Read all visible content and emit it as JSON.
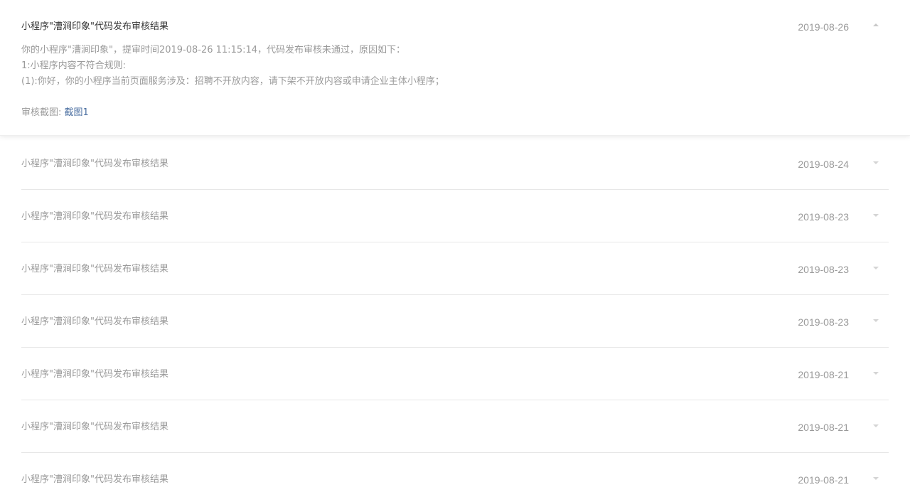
{
  "expanded": {
    "title": "小程序\"漕涧印象\"代码发布审核结果",
    "date": "2019-08-26",
    "lines": [
      "你的小程序\"漕涧印象\"，提审时间2019-08-26 11:15:14，代码发布审核未通过，原因如下：",
      "1:小程序内容不符合规则:",
      "(1):你好，你的小程序当前页面服务涉及：招聘不开放内容，请下架不开放内容或申请企业主体小程序；"
    ],
    "screenshot_label": "审核截图: ",
    "screenshot_link": "截图1"
  },
  "rows": [
    {
      "title": "小程序\"漕涧印象\"代码发布审核结果",
      "date": "2019-08-24"
    },
    {
      "title": "小程序\"漕涧印象\"代码发布审核结果",
      "date": "2019-08-23"
    },
    {
      "title": "小程序\"漕涧印象\"代码发布审核结果",
      "date": "2019-08-23"
    },
    {
      "title": "小程序\"漕涧印象\"代码发布审核结果",
      "date": "2019-08-23"
    },
    {
      "title": "小程序\"漕涧印象\"代码发布审核结果",
      "date": "2019-08-21"
    },
    {
      "title": "小程序\"漕涧印象\"代码发布审核结果",
      "date": "2019-08-21"
    },
    {
      "title": "小程序\"漕涧印象\"代码发布审核结果",
      "date": "2019-08-21"
    }
  ],
  "icons": {
    "expanded": "chevron-up-icon",
    "collapsed": "chevron-down-icon"
  }
}
